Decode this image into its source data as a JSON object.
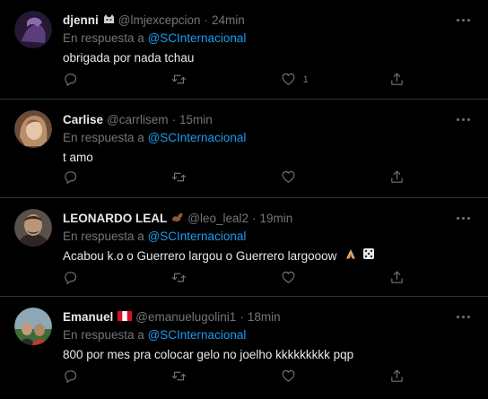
{
  "reply_prefix": "En respuesta a",
  "tweets": [
    {
      "name": "djenni",
      "badge": "cat-emoji",
      "handle": "@lmjexcepcion",
      "sep": "·",
      "time": "24min",
      "mention": "@SCInternacional",
      "text": "obrigada por nada tchau",
      "like_count": "1",
      "avatar_colors": [
        "#2a1a3a",
        "#6a4a8a"
      ]
    },
    {
      "name": "Carlise",
      "badge": "",
      "handle": "@carrlisem",
      "sep": "·",
      "time": "15min",
      "mention": "@SCInternacional",
      "text": "t amo",
      "like_count": "",
      "avatar_colors": [
        "#c9a98c",
        "#5a3a2a"
      ]
    },
    {
      "name": "LEONARDO LEAL",
      "badge": "flexed-arm-emoji",
      "handle": "@leo_leal2",
      "sep": "·",
      "time": "19min",
      "mention": "@SCInternacional",
      "text": "Acabou k.o o Guerrero largou o Guerrero largooow",
      "text_emojis": [
        "folded-hands-emoji",
        "dice-emoji"
      ],
      "like_count": "",
      "avatar_colors": [
        "#8a7a6a",
        "#3a2a20"
      ]
    },
    {
      "name": "Emanuel",
      "badge": "peru-flag-emoji",
      "handle": "@emanuelugolini1",
      "sep": "·",
      "time": "18min",
      "mention": "@SCInternacional",
      "text": "800 por mes pra colocar gelo no joelho kkkkkkkkk pqp",
      "like_count": "",
      "avatar_colors": [
        "#4a6a3a",
        "#9ab0c0"
      ]
    }
  ],
  "colors": {
    "background": "#000000",
    "text": "#e7e9ea",
    "muted": "#71767b",
    "link": "#1d9bf0",
    "divider": "#2f3336"
  }
}
